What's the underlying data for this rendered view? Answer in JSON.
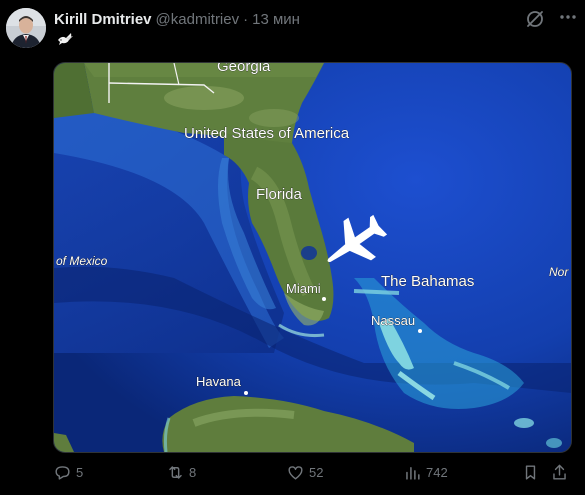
{
  "tweet": {
    "author_name": "Kirill Dmitriev",
    "handle": "@kadmitriev",
    "separator": "·",
    "time": "13 мин",
    "emoji": "dove-emoji"
  },
  "map": {
    "labels": {
      "georgia": "Georgia",
      "usa": "United States of America",
      "florida": "Florida",
      "gulf": "of Mexico",
      "bahamas": "The Bahamas",
      "north": "Nor",
      "miami": "Miami",
      "nassau": "Nassau",
      "havana": "Havana"
    },
    "colors": {
      "ocean_deep": "#0a2a86",
      "ocean_mid": "#1747c0",
      "shelf": "#2a9fd8",
      "land": "#5b7b3c",
      "land_light": "#7c9b55",
      "plane": "#ffffff"
    }
  },
  "actions": {
    "replies": "5",
    "reposts": "8",
    "likes": "52",
    "views": "742"
  },
  "icons": [
    "avatar",
    "grok-icon",
    "more-icon",
    "reply-icon",
    "repost-icon",
    "like-icon",
    "views-icon",
    "bookmark-icon",
    "share-icon",
    "airplane-icon"
  ]
}
